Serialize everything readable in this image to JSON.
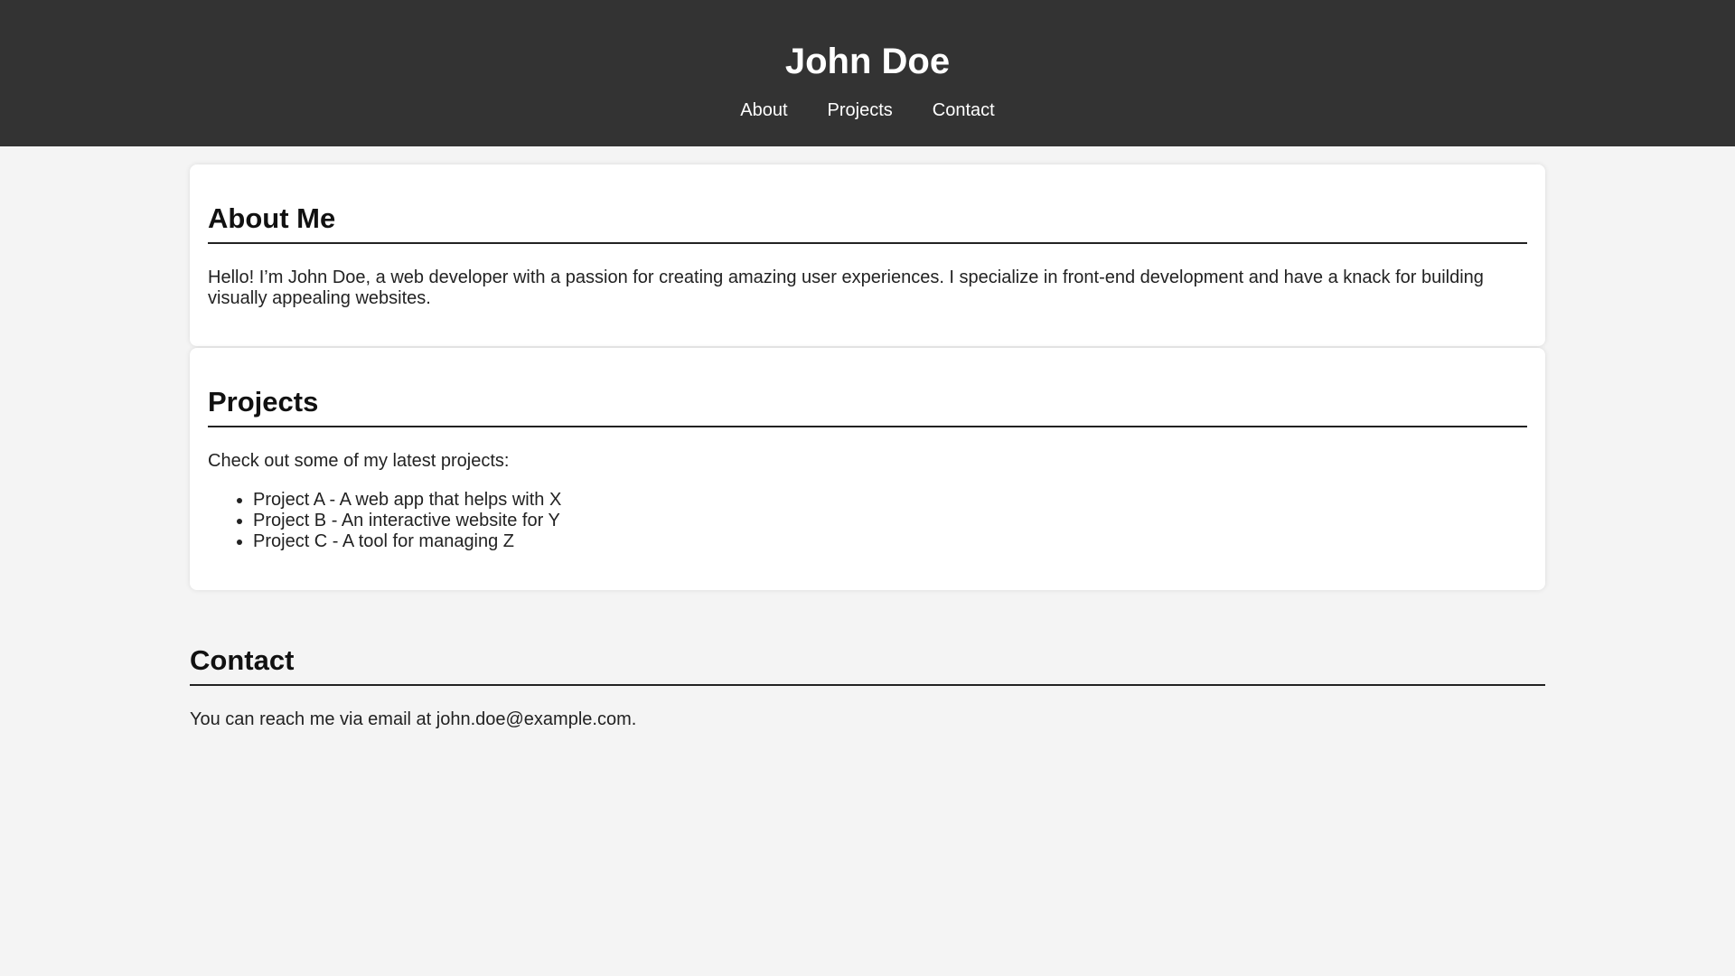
{
  "header": {
    "title": "John Doe",
    "nav": [
      {
        "label": "About"
      },
      {
        "label": "Projects"
      },
      {
        "label": "Contact"
      }
    ]
  },
  "about": {
    "heading": "About Me",
    "text": "Hello! I’m John Doe, a web developer with a passion for creating amazing user experiences. I specialize in front-end development and have a knack for building visually appealing websites."
  },
  "projects": {
    "heading": "Projects",
    "intro": "Check out some of my latest projects:",
    "items": [
      "Project A - A web app that helps with X",
      "Project B - An interactive website for Y",
      "Project C - A tool for managing Z"
    ]
  },
  "contact": {
    "heading": "Contact",
    "text_prefix": "You can reach me via email at ",
    "email": "john.doe@example.com",
    "text_suffix": "."
  },
  "colors": {
    "header_bg": "#333333",
    "page_bg": "#f4f4f4",
    "card_bg": "#ffffff"
  }
}
